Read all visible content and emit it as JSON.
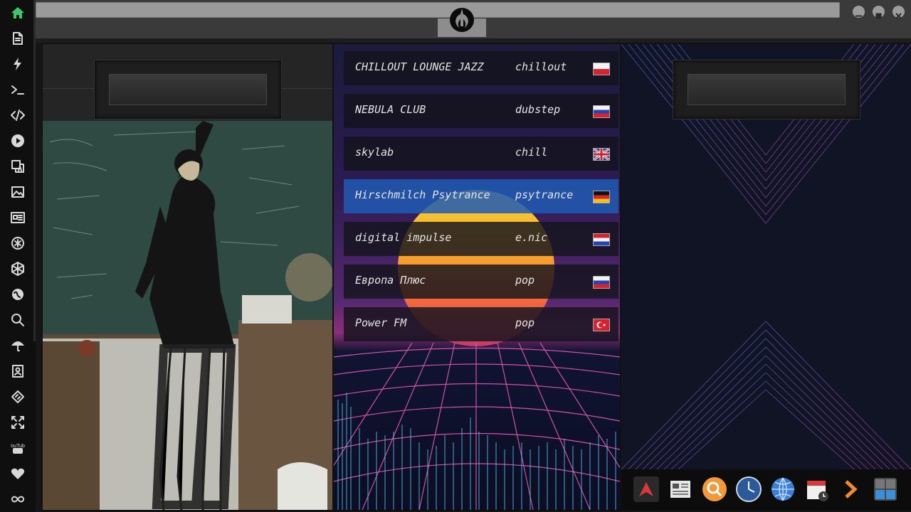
{
  "sidebar": {
    "items": [
      {
        "icon": "home-icon",
        "active": true
      },
      {
        "icon": "document-icon"
      },
      {
        "icon": "lightning-icon"
      },
      {
        "icon": "terminal-icon"
      },
      {
        "icon": "code-icon"
      },
      {
        "icon": "play-icon"
      },
      {
        "icon": "translate-icon"
      },
      {
        "icon": "image-icon"
      },
      {
        "icon": "news-icon"
      },
      {
        "icon": "asterisk-icon"
      },
      {
        "icon": "hexagon-icon"
      },
      {
        "icon": "globe-icon"
      },
      {
        "icon": "search-icon"
      },
      {
        "icon": "umbrella-icon"
      },
      {
        "icon": "contact-card-icon"
      },
      {
        "icon": "code-diamond-icon"
      },
      {
        "icon": "expand-icon"
      },
      {
        "icon": "youtube-icon",
        "label": "You Tube"
      },
      {
        "icon": "heart-icon"
      },
      {
        "icon": "infinity-icon"
      }
    ]
  },
  "header": {
    "logo_icon": "rebel-alliance-icon"
  },
  "colors": {
    "accent_green": "#37c96b",
    "active_station": "#205ab4"
  },
  "stations": [
    {
      "name": "CHILLOUT LOUNGE JAZZ",
      "genre": "chillout",
      "flag": "poland"
    },
    {
      "name": "NEBULA CLUB",
      "genre": "dubstep",
      "flag": "russia"
    },
    {
      "name": "skylab",
      "genre": "chill",
      "flag": "united-kingdom"
    },
    {
      "name": "Hirschmilch Psytrance",
      "genre": "psytrance",
      "flag": "germany",
      "active": true
    },
    {
      "name": "digital impulse",
      "genre": "e.nic",
      "flag": "croatia"
    },
    {
      "name": "Европа Плюс",
      "genre": "pop",
      "flag": "russia"
    },
    {
      "name": "Power FM",
      "genre": "pop",
      "flag": "turkey"
    }
  ],
  "dock": {
    "items": [
      "app-launcher-icon",
      "news-reader-icon",
      "search-icon",
      "clock-icon",
      "web-browser-icon",
      "calendar-icon",
      "chevron-right-icon",
      "calculator-icon"
    ]
  }
}
